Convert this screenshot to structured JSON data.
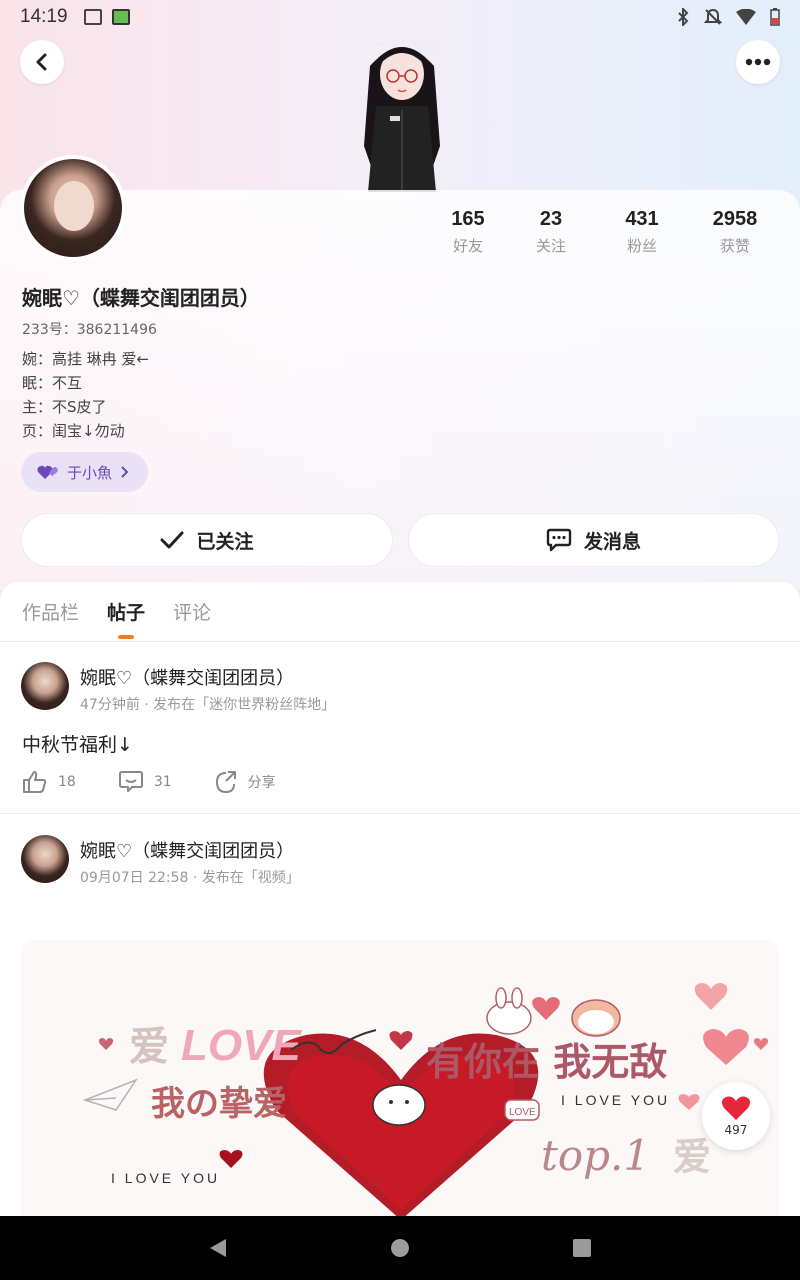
{
  "status_bar": {
    "time": "14:19"
  },
  "profile": {
    "name": "婉眠♡（蝶舞交闺团团员）",
    "uid": "233号：386211496",
    "bio": [
      "婉：高挂 琳冉 爱←",
      "眠：不互",
      "主：不S皮了",
      "页：闺宝↓勿动"
    ],
    "tag_label": "于小魚"
  },
  "stats": [
    {
      "num": "165",
      "label": "好友"
    },
    {
      "num": "23",
      "label": "关注"
    },
    {
      "num": "431",
      "label": "粉丝"
    },
    {
      "num": "2958",
      "label": "获赞"
    }
  ],
  "actions": {
    "follow_label": "已关注",
    "message_label": "发消息"
  },
  "tabs": [
    "作品栏",
    "帖子",
    "评论"
  ],
  "posts": [
    {
      "author": "婉眠♡（蝶舞交闺团团员）",
      "meta": "47分钟前 · 发布在「迷你世界粉丝阵地」",
      "text": "中秋节福利↓",
      "likes": "18",
      "comments": "31",
      "share_label": "分享"
    },
    {
      "author": "婉眠♡（蝶舞交闺团团员）",
      "meta": "09月07日 22:58 · 发布在「视频」",
      "image_text": {
        "love_big": "LOVE",
        "ai": "爱",
        "zhiai": "我の挚爱",
        "slogan": "有你在 我无敌",
        "iloveyou_right": "I LOVE YOU",
        "iloveyou_left": "I LOVE YOU",
        "top": "top.1",
        "small_love": "LOVE",
        "ai_right": "爱"
      }
    }
  ],
  "floating_like": {
    "count": "497"
  },
  "colors": {
    "accent_orange": "#ff7a22",
    "tag_purple": "#6a4ab8",
    "heart_red": "#e8283a"
  }
}
